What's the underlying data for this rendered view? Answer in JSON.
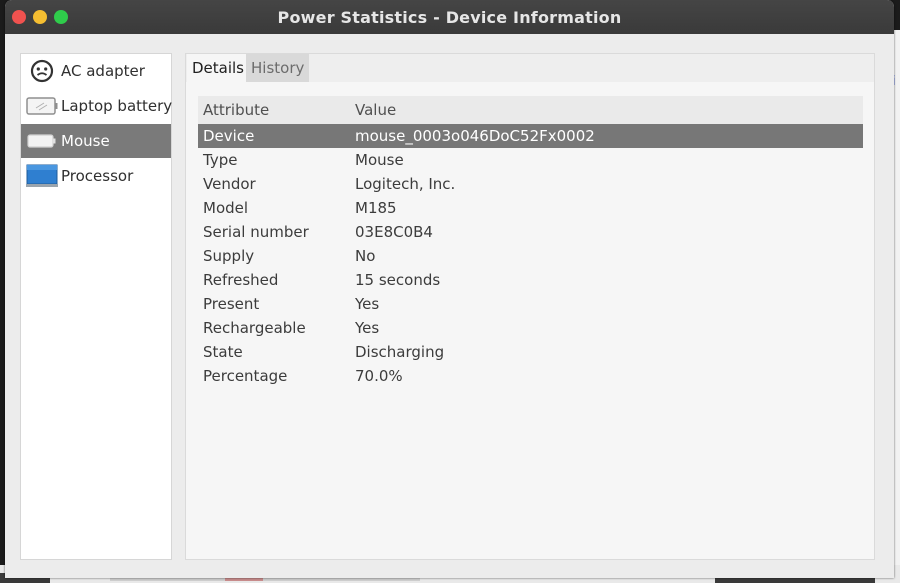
{
  "window": {
    "title": "Power Statistics - Device Information"
  },
  "sidebar": {
    "items": [
      {
        "label": "AC adapter",
        "icon": "ac-adapter-icon"
      },
      {
        "label": "Laptop battery",
        "icon": "laptop-battery-icon"
      },
      {
        "label": "Mouse",
        "icon": "mouse-battery-icon",
        "selected": true
      },
      {
        "label": "Processor",
        "icon": "processor-icon"
      }
    ]
  },
  "tabs": [
    {
      "label": "Details",
      "active": true
    },
    {
      "label": "History",
      "active": false
    }
  ],
  "table": {
    "headers": {
      "attribute": "Attribute",
      "value": "Value"
    },
    "rows": [
      {
        "attribute": "Device",
        "value": "mouse_0003o046DoC52Fx0002"
      },
      {
        "attribute": "Type",
        "value": "Mouse"
      },
      {
        "attribute": "Vendor",
        "value": "Logitech, Inc."
      },
      {
        "attribute": "Model",
        "value": "M185"
      },
      {
        "attribute": "Serial number",
        "value": "03E8C0B4"
      },
      {
        "attribute": "Supply",
        "value": "No"
      },
      {
        "attribute": "Refreshed",
        "value": "15 seconds"
      },
      {
        "attribute": "Present",
        "value": "Yes"
      },
      {
        "attribute": "Rechargeable",
        "value": "Yes"
      },
      {
        "attribute": "State",
        "value": "Discharging"
      },
      {
        "attribute": "Percentage",
        "value": "70.0%"
      }
    ]
  },
  "colors": {
    "selection": "#777777",
    "titlebar": "#3e3e3e"
  }
}
